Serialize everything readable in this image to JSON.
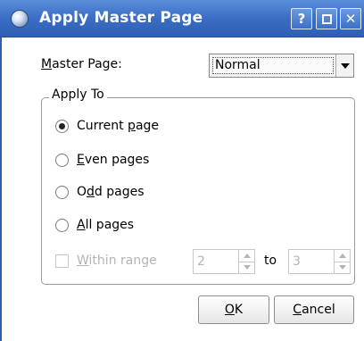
{
  "window": {
    "title": "Apply Master Page"
  },
  "titlebar": {
    "help_label": "?",
    "close_label": "✕"
  },
  "master_page": {
    "label_mnemonic": "M",
    "label_rest": "aster Page:",
    "selected_value": "Normal"
  },
  "apply_to": {
    "group_title": "Apply To",
    "options": [
      {
        "pre": "Current ",
        "mnemonic": "p",
        "post": "age",
        "checked": true
      },
      {
        "pre": "",
        "mnemonic": "E",
        "post": "ven pages",
        "checked": false
      },
      {
        "pre": "O",
        "mnemonic": "d",
        "post": "d pages",
        "checked": false
      },
      {
        "pre": "",
        "mnemonic": "A",
        "post": "ll pages",
        "checked": false
      }
    ],
    "within_range": {
      "mnemonic": "W",
      "rest": "ithin range",
      "from_value": "2",
      "to_label": "to",
      "to_value": "3",
      "checked": false,
      "enabled": false
    }
  },
  "buttons": {
    "ok_mnemonic": "O",
    "ok_rest": "K",
    "cancel_mnemonic": "C",
    "cancel_rest": "ancel"
  },
  "colors": {
    "titlebar": "#3a6dc4",
    "disabled_text": "#b4b4b4"
  }
}
